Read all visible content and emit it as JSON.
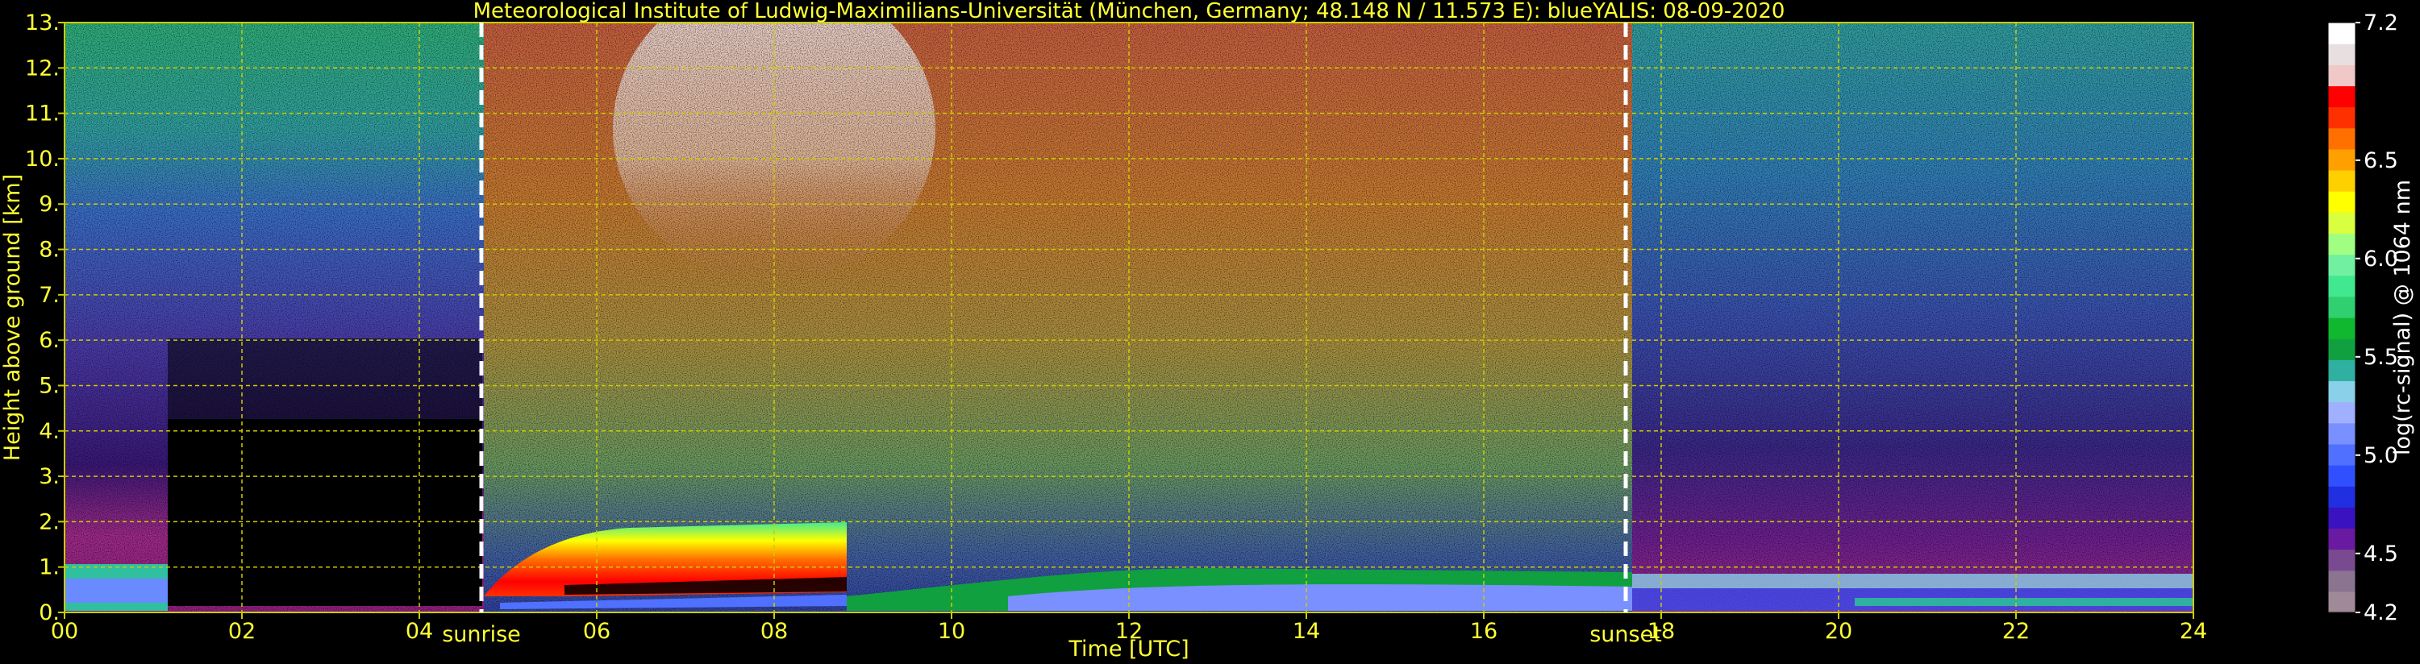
{
  "chart_data": {
    "type": "heatmap",
    "title": "Meteorological Institute of Ludwig-Maximilians-Universität (München, Germany; 48.148 N / 11.573 E):     blueYALIS: 08-09-2020",
    "xlabel": "Time [UTC]",
    "ylabel": "Height above ground [km]",
    "xlim": [
      0,
      24
    ],
    "ylim": [
      0,
      13
    ],
    "x_ticks": [
      "00",
      "02",
      "04",
      "06",
      "08",
      "10",
      "12",
      "14",
      "16",
      "18",
      "20",
      "22",
      "24"
    ],
    "y_ticks": [
      "0.",
      "1.",
      "2.",
      "3.",
      "4.",
      "5.",
      "6.",
      "7.",
      "8.",
      "9.",
      "10.",
      "11.",
      "12.",
      "13."
    ],
    "grid": true,
    "markers": [
      {
        "label": "sunrise",
        "x": 4.7
      },
      {
        "label": "sunset",
        "x": 17.6
      }
    ],
    "colorbar": {
      "label": "log(rc-signal) @ 1064 nm",
      "range": [
        4.2,
        7.2
      ],
      "ticks": [
        "4.2",
        "4.5",
        "5.0",
        "5.5",
        "6.0",
        "6.5",
        "7.2"
      ],
      "colors": [
        "#a08a98",
        "#8a7490",
        "#7a4a90",
        "#6a1aa0",
        "#3a12c0",
        "#2030e0",
        "#3050ff",
        "#5070ff",
        "#7a90ff",
        "#a0b0ff",
        "#8ad0e8",
        "#30b0a0",
        "#10a040",
        "#10b830",
        "#30d070",
        "#40e890",
        "#70f0a0",
        "#a0ff80",
        "#d8ff40",
        "#ffff00",
        "#ffd000",
        "#ffa000",
        "#ff7000",
        "#ff3000",
        "#ff0000",
        "#f0c8c8",
        "#e8e0e0",
        "#ffffff"
      ]
    },
    "colors": {
      "text": "#ffff33",
      "grid": "#cccc00",
      "marker": "#ffffff",
      "background": "#000000"
    }
  }
}
